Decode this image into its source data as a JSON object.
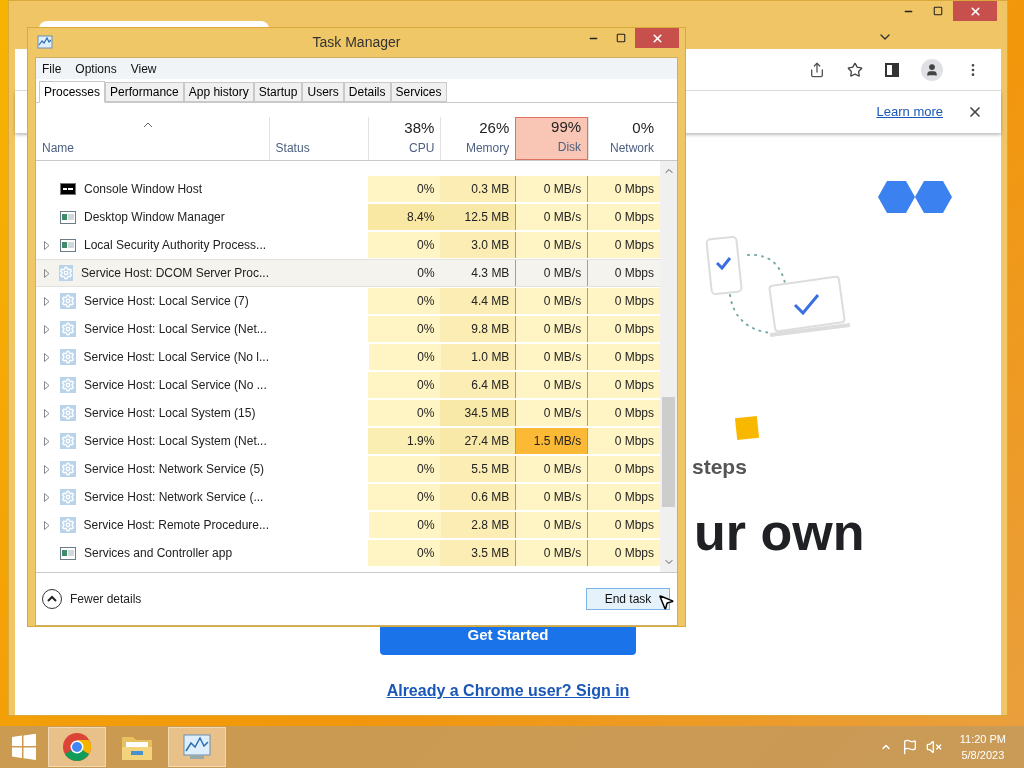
{
  "browser": {
    "infobar_link": "Learn more",
    "heading_fragments": [
      "steps",
      "ur own"
    ],
    "button": "Get Started",
    "sign_in_link": "Already a Chrome user? Sign in"
  },
  "task_manager": {
    "title": "Task Manager",
    "menu": [
      "File",
      "Options",
      "View"
    ],
    "tabs": [
      {
        "label": "Processes",
        "selected": true
      },
      {
        "label": "Performance",
        "selected": false
      },
      {
        "label": "App history",
        "selected": false
      },
      {
        "label": "Startup",
        "selected": false
      },
      {
        "label": "Users",
        "selected": false
      },
      {
        "label": "Details",
        "selected": false
      },
      {
        "label": "Services",
        "selected": false
      }
    ],
    "name_column": "Name",
    "status_column": "Status",
    "metric_columns": [
      {
        "percent": "38%",
        "name": "CPU",
        "highlighted": false
      },
      {
        "percent": "26%",
        "name": "Memory",
        "highlighted": false
      },
      {
        "percent": "99%",
        "name": "Disk",
        "highlighted": true
      },
      {
        "percent": "0%",
        "name": "Network",
        "highlighted": false
      }
    ],
    "rows": [
      {
        "name": "Console Window Host",
        "kind": "console",
        "expandable": false,
        "selected": false,
        "cells": [
          {
            "text": "0%",
            "color": "#fff4c4"
          },
          {
            "text": "0.3 MB",
            "color": "#fbedb3"
          },
          {
            "text": "0 MB/s",
            "color": "#fff4c4"
          },
          {
            "text": "0 Mbps",
            "color": "#fff4c4"
          }
        ]
      },
      {
        "name": "Desktop Window Manager",
        "kind": "window",
        "expandable": false,
        "selected": false,
        "cells": [
          {
            "text": "8.4%",
            "color": "#f9e8a4"
          },
          {
            "text": "12.5 MB",
            "color": "#f9e9a8"
          },
          {
            "text": "0 MB/s",
            "color": "#fff4c4"
          },
          {
            "text": "0 Mbps",
            "color": "#fff4c4"
          }
        ]
      },
      {
        "name": "Local Security Authority Process...",
        "kind": "window",
        "expandable": true,
        "selected": false,
        "cells": [
          {
            "text": "0%",
            "color": "#fff4c4"
          },
          {
            "text": "3.0 MB",
            "color": "#fbedb3"
          },
          {
            "text": "0 MB/s",
            "color": "#fff4c4"
          },
          {
            "text": "0 Mbps",
            "color": "#fff4c4"
          }
        ]
      },
      {
        "name": "Service Host: DCOM Server Proc...",
        "kind": "service",
        "expandable": true,
        "selected": true,
        "cells": [
          {
            "text": "0%",
            "color": "#f5f3ee"
          },
          {
            "text": "4.3 MB",
            "color": "#f5f3ee"
          },
          {
            "text": "0 MB/s",
            "color": "#f5f3ee"
          },
          {
            "text": "0 Mbps",
            "color": "#f5f3ee"
          }
        ]
      },
      {
        "name": "Service Host: Local Service (7)",
        "kind": "service",
        "expandable": true,
        "selected": false,
        "cells": [
          {
            "text": "0%",
            "color": "#fff4c4"
          },
          {
            "text": "4.4 MB",
            "color": "#fbedb3"
          },
          {
            "text": "0 MB/s",
            "color": "#fff4c4"
          },
          {
            "text": "0 Mbps",
            "color": "#fff4c4"
          }
        ]
      },
      {
        "name": "Service Host: Local Service (Net...",
        "kind": "service",
        "expandable": true,
        "selected": false,
        "cells": [
          {
            "text": "0%",
            "color": "#fff4c4"
          },
          {
            "text": "9.8 MB",
            "color": "#fbedb3"
          },
          {
            "text": "0 MB/s",
            "color": "#fff4c4"
          },
          {
            "text": "0 Mbps",
            "color": "#fff4c4"
          }
        ]
      },
      {
        "name": "Service Host: Local Service (No l...",
        "kind": "service",
        "expandable": true,
        "selected": false,
        "cells": [
          {
            "text": "0%",
            "color": "#fff4c4"
          },
          {
            "text": "1.0 MB",
            "color": "#fbedb3"
          },
          {
            "text": "0 MB/s",
            "color": "#fff4c4"
          },
          {
            "text": "0 Mbps",
            "color": "#fff4c4"
          }
        ]
      },
      {
        "name": "Service Host: Local Service (No ...",
        "kind": "service",
        "expandable": true,
        "selected": false,
        "cells": [
          {
            "text": "0%",
            "color": "#fff4c4"
          },
          {
            "text": "6.4 MB",
            "color": "#fbedb3"
          },
          {
            "text": "0 MB/s",
            "color": "#fff4c4"
          },
          {
            "text": "0 Mbps",
            "color": "#fff4c4"
          }
        ]
      },
      {
        "name": "Service Host: Local System (15)",
        "kind": "service",
        "expandable": true,
        "selected": false,
        "cells": [
          {
            "text": "0%",
            "color": "#fff4c4"
          },
          {
            "text": "34.5 MB",
            "color": "#f9e9a8"
          },
          {
            "text": "0 MB/s",
            "color": "#fff4c4"
          },
          {
            "text": "0 Mbps",
            "color": "#fff4c4"
          }
        ]
      },
      {
        "name": "Service Host: Local System (Net...",
        "kind": "service",
        "expandable": true,
        "selected": false,
        "cells": [
          {
            "text": "1.9%",
            "color": "#fbeeb2"
          },
          {
            "text": "27.4 MB",
            "color": "#f9e9a8"
          },
          {
            "text": "1.5 MB/s",
            "color": "#fcb935"
          },
          {
            "text": "0 Mbps",
            "color": "#fff4c4"
          }
        ]
      },
      {
        "name": "Service Host: Network Service (5)",
        "kind": "service",
        "expandable": true,
        "selected": false,
        "cells": [
          {
            "text": "0%",
            "color": "#fff4c4"
          },
          {
            "text": "5.5 MB",
            "color": "#fbedb3"
          },
          {
            "text": "0 MB/s",
            "color": "#fff4c4"
          },
          {
            "text": "0 Mbps",
            "color": "#fff4c4"
          }
        ]
      },
      {
        "name": "Service Host: Network Service (...",
        "kind": "service",
        "expandable": true,
        "selected": false,
        "cells": [
          {
            "text": "0%",
            "color": "#fff4c4"
          },
          {
            "text": "0.6 MB",
            "color": "#fbedb3"
          },
          {
            "text": "0 MB/s",
            "color": "#fff4c4"
          },
          {
            "text": "0 Mbps",
            "color": "#fff4c4"
          }
        ]
      },
      {
        "name": "Service Host: Remote Procedure...",
        "kind": "service",
        "expandable": true,
        "selected": false,
        "cells": [
          {
            "text": "0%",
            "color": "#fff4c4"
          },
          {
            "text": "2.8 MB",
            "color": "#fbedb3"
          },
          {
            "text": "0 MB/s",
            "color": "#fff4c4"
          },
          {
            "text": "0 Mbps",
            "color": "#fff4c4"
          }
        ]
      },
      {
        "name": "Services and Controller app",
        "kind": "window",
        "expandable": false,
        "selected": false,
        "cells": [
          {
            "text": "0%",
            "color": "#fff4c4"
          },
          {
            "text": "3.5 MB",
            "color": "#fbedb3"
          },
          {
            "text": "0 MB/s",
            "color": "#fff4c4"
          },
          {
            "text": "0 Mbps",
            "color": "#fff4c4"
          }
        ]
      }
    ],
    "footer": {
      "toggle": "Fewer details",
      "button": "End task"
    }
  },
  "taskbar": {
    "apps": [
      {
        "kind": "chrome",
        "highlighted": true
      },
      {
        "kind": "explorer",
        "highlighted": false
      },
      {
        "kind": "taskmgr",
        "highlighted": true
      }
    ],
    "time": "11:20 PM",
    "date": "5/8/2023"
  }
}
